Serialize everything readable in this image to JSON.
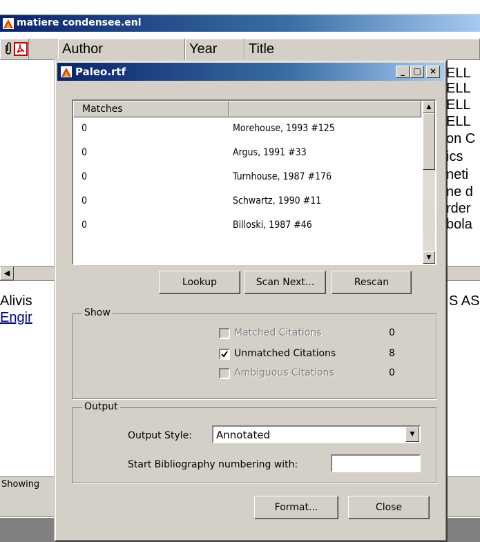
{
  "library_window": {
    "title": "matiere condensee.enl",
    "columns": {
      "author": "Author",
      "year": "Year",
      "title": "Title"
    },
    "right_text_fragments": [
      "ELL",
      "ELL",
      "ELL",
      "ELL",
      "on C",
      "ics",
      "neti",
      "ne d",
      "rder",
      "bola"
    ],
    "preview_lines": [
      "Alivis",
      "Engir"
    ],
    "preview_right": "S AS",
    "status_text": "Showing"
  },
  "dialog": {
    "title": "Paleo.rtf",
    "title_buttons": {
      "minimize": "_",
      "maximize": "□",
      "close": "×"
    },
    "list_header": "Matches",
    "rows": [
      {
        "matches": "0",
        "citation": "Morehouse, 1993 #125"
      },
      {
        "matches": "0",
        "citation": "Argus, 1991 #33"
      },
      {
        "matches": "0",
        "citation": "Turnhouse, 1987 #176"
      },
      {
        "matches": "0",
        "citation": "Schwartz, 1990 #11"
      },
      {
        "matches": "0",
        "citation": "Billoski, 1987 #46"
      }
    ],
    "buttons": {
      "lookup": "Lookup",
      "scan_next": "Scan Next...",
      "rescan": "Rescan",
      "format": "Format...",
      "close": "Close"
    },
    "show": {
      "label": "Show",
      "matched": {
        "label": "Matched Citations",
        "count": "0",
        "checked": false,
        "enabled": false
      },
      "unmatched": {
        "label": "Unmatched Citations",
        "count": "8",
        "checked": true,
        "enabled": true
      },
      "ambiguous": {
        "label": "Ambiguous Citations",
        "count": "0",
        "checked": false,
        "enabled": false
      }
    },
    "output": {
      "label": "Output",
      "style_label": "Output Style:",
      "style_value": "Annotated",
      "numbering_label": "Start Bibliography numbering with:",
      "numbering_value": ""
    }
  }
}
